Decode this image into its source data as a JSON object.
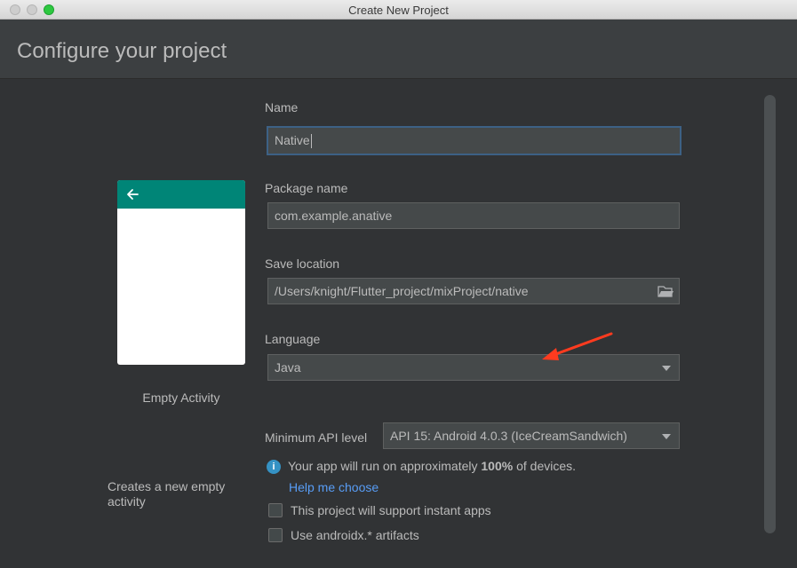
{
  "window": {
    "title": "Create New Project"
  },
  "header": {
    "title": "Configure your project"
  },
  "template": {
    "caption": "Empty Activity",
    "description": "Creates a new empty activity"
  },
  "form": {
    "name": {
      "label": "Name",
      "value": "Native"
    },
    "package": {
      "label": "Package name",
      "value": "com.example.anative"
    },
    "location": {
      "label": "Save location",
      "value": "/Users/knight/Flutter_project/mixProject/native"
    },
    "language": {
      "label": "Language",
      "value": "Java"
    },
    "min_api": {
      "label": "Minimum API level",
      "value": "API 15: Android 4.0.3 (IceCreamSandwich)"
    }
  },
  "info": {
    "prefix": "Your app will run on approximately ",
    "percent": "100%",
    "suffix": " of devices.",
    "help_link": "Help me choose",
    "icon": "i"
  },
  "options": {
    "instant_apps": {
      "label": "This project will support instant apps",
      "checked": false
    },
    "androidx": {
      "label": "Use androidx.* artifacts",
      "checked": false
    }
  },
  "colors": {
    "accent": "#008577",
    "link": "#589df6",
    "annotation_arrow": "#ff3b1f"
  }
}
